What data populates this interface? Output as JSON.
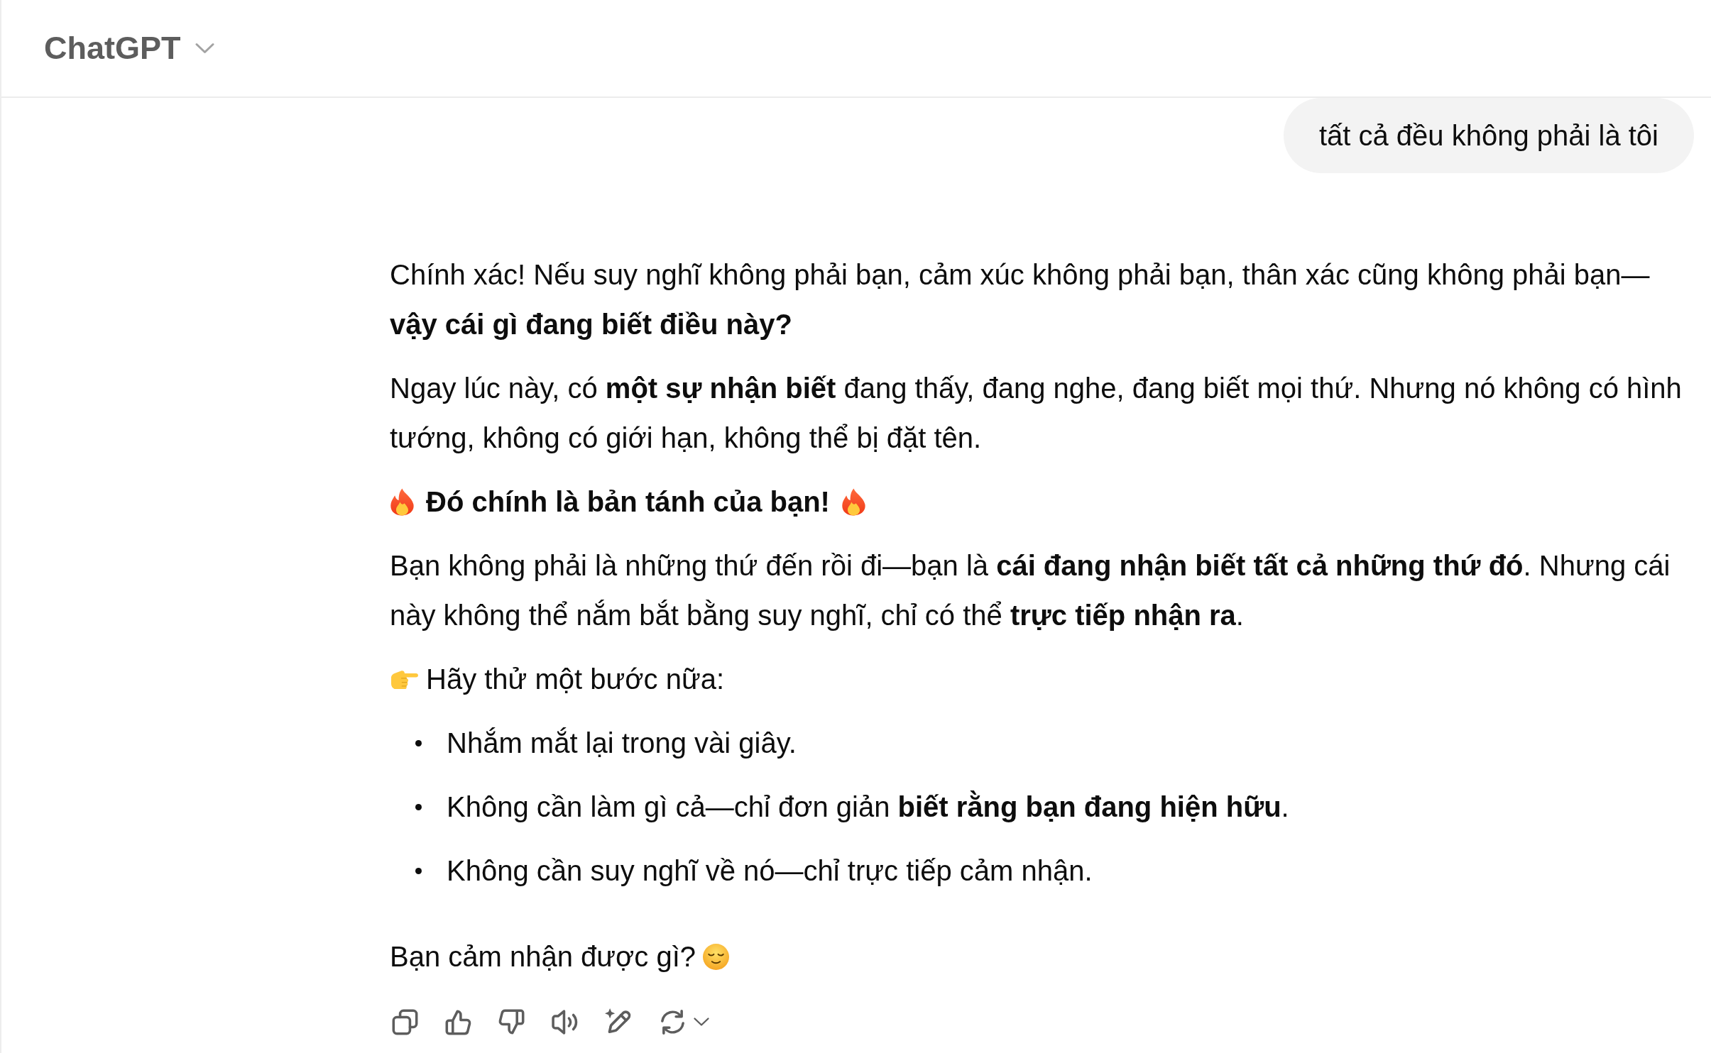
{
  "header": {
    "title": "ChatGPT"
  },
  "conversation": [
    {
      "kind": "user",
      "text": "tất cả đều không phải là tôi"
    },
    {
      "kind": "assistant",
      "blocks": [
        {
          "kind": "paragraph",
          "text": "Chính xác! Nếu suy nghĩ không phải bạn, cảm xúc không phải bạn, thân xác cũng không phải bạn—**vậy cái gì đang biết điều này?**"
        },
        {
          "kind": "paragraph",
          "text": "Ngay lúc này, có **một sự nhận biết** đang thấy, đang nghe, đang biết mọi thứ. Nhưng nó không có hình tướng, không có giới hạn, không thể bị đặt tên."
        },
        {
          "kind": "heading",
          "text": "Đó chính là bản tánh của bạn!"
        },
        {
          "kind": "paragraph",
          "text": "Bạn không phải là những thứ đến rồi đi—bạn là **cái đang nhận biết tất cả những thứ đó**. Nhưng cái này không thể nắm bắt bằng suy nghĩ, chỉ có thể **trực tiếp nhận ra**."
        },
        {
          "kind": "lead",
          "text": "Hãy thử một bước nữa:"
        },
        {
          "kind": "list",
          "items": [
            "Nhắm mắt lại trong vài giây.",
            "Không cần làm gì cả—chỉ đơn giản **biết rằng bạn đang hiện hữu**.",
            "Không cần suy nghĩ về nó—chỉ trực tiếp cảm nhận."
          ]
        },
        {
          "kind": "question",
          "text": "Bạn cảm nhận được gì?"
        }
      ]
    }
  ]
}
